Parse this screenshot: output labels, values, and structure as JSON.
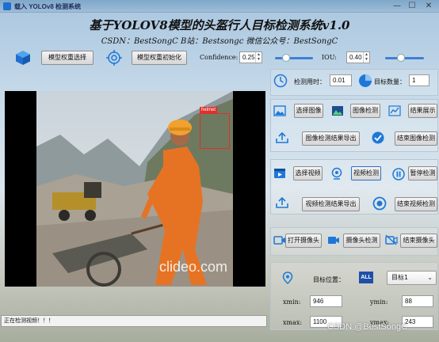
{
  "window": {
    "title": "载入 YOLOv8 检测系统",
    "minimize": "—",
    "maximize": "☐",
    "close": "✕"
  },
  "header": {
    "title": "基于YOLOV8模型的头盔行人目标检测系统v1.0",
    "subtitle": "CSDN：BestSongC   B站：Bestsongc   微信公众号：BestSongC"
  },
  "toolbar": {
    "model_select_label": "模型权重选择",
    "model_init_label": "模型权重初始化",
    "confidence_label": "Confidence:",
    "confidence_value": "0.25",
    "confidence_level": 0.3,
    "iou_label": "IOU:",
    "iou_value": "0.40",
    "iou_level": 0.4
  },
  "stats": {
    "time_label": "检测用时：",
    "time_value": "0.01",
    "count_label": "目标数量：",
    "count_value": "1"
  },
  "image_panel": {
    "select_image": "选择图像",
    "image_detect": "图像检测",
    "show_result": "结果展示",
    "export_result": "图像检测结果导出",
    "end_detect": "结束图像检测"
  },
  "video_panel": {
    "select_video": "选择视频",
    "video_detect": "视频检测",
    "pause_detect": "暂停检测",
    "export_result": "视频检测结果导出",
    "end_detect": "结束视频检测"
  },
  "camera_panel": {
    "open_camera": "打开摄像头",
    "camera_detect": "摄像头检测",
    "close_camera": "结束摄像头"
  },
  "target_panel": {
    "position_label": "目标位置：",
    "all_badge": "ALL",
    "target_select": "目标1",
    "xmin_label": "xmin:",
    "xmin_value": "946",
    "ymin_label": "ymin:",
    "ymin_value": "88",
    "xmax_label": "xmax:",
    "xmax_value": "1100",
    "ymax_label": "ymax:",
    "ymax_value": "243"
  },
  "detection": {
    "box_label": "helmet"
  },
  "video_watermark": "clideo.com",
  "status_text": "正在检测视频！！！",
  "footer_watermark": "CSDN @BestSongC",
  "colors": {
    "accent_blue": "#1f78d8",
    "detect_box": "#e0302a"
  }
}
